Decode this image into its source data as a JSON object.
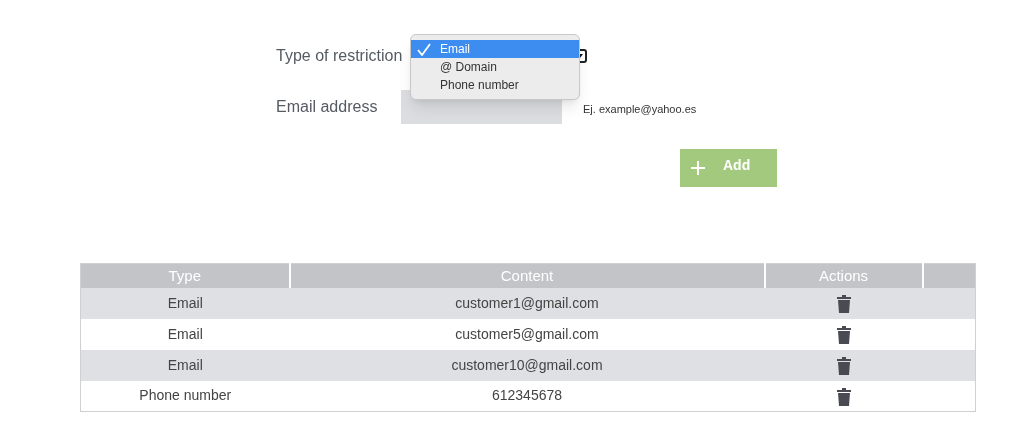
{
  "form": {
    "restriction_label": "Type of restriction",
    "menu_options": [
      {
        "label": "Email",
        "selected": true
      },
      {
        "label": "@ Domain",
        "selected": false
      },
      {
        "label": "Phone number",
        "selected": false
      }
    ],
    "email_label": "Email address",
    "email_hint": "Ej. example@yahoo.es",
    "add_button": "Add"
  },
  "table": {
    "columns": [
      "Type",
      "Content",
      "Actions"
    ],
    "rows": [
      {
        "type": "Email",
        "content": "customer1@gmail.com"
      },
      {
        "type": "Email",
        "content": "customer5@gmail.com"
      },
      {
        "type": "Email",
        "content": "customer10@gmail.com"
      },
      {
        "type": "Phone number",
        "content": "612345678"
      }
    ]
  }
}
